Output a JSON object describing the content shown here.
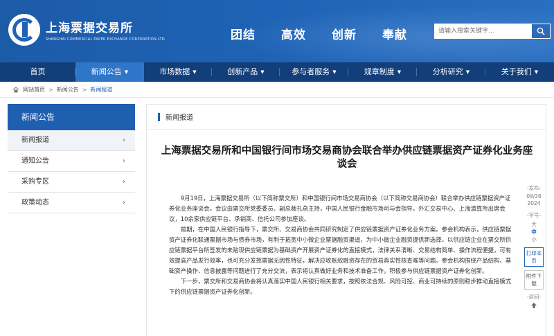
{
  "header": {
    "logo_cn": "上海票据交易所",
    "logo_en": "SHANGHAI COMMERCIAL PAPER EXCHANGE CORPORATION LTD.",
    "slogans": [
      "团结",
      "高效",
      "创新",
      "奉献"
    ],
    "search_placeholder": "请输入搜索关键字..."
  },
  "nav": {
    "items": [
      {
        "label": "首页",
        "caret": ""
      },
      {
        "label": "新闻公告",
        "caret": "▼"
      },
      {
        "label": "市场数据",
        "caret": "▼"
      },
      {
        "label": "创新产品",
        "caret": "▼"
      },
      {
        "label": "参与者服务",
        "caret": "▼"
      },
      {
        "label": "规章制度",
        "caret": "▼"
      },
      {
        "label": "分析研究",
        "caret": "▼"
      },
      {
        "label": "关于我们",
        "caret": "▼"
      }
    ]
  },
  "breadcrumb": {
    "items": [
      "网站首页",
      "新闻公告",
      "新闻报道"
    ],
    "separator": ">"
  },
  "sidebar": {
    "title": "新闻公告",
    "items": [
      {
        "label": "新闻报道",
        "arrow": "›"
      },
      {
        "label": "通知公告",
        "arrow": "›"
      },
      {
        "label": "采购专区",
        "arrow": "›"
      },
      {
        "label": "政策动态",
        "arrow": "›"
      }
    ]
  },
  "main": {
    "section_label": "新闻报道",
    "title": "上海票据交易所和中国银行间市场交易商协会联合举办供应链票据资产证券化业务座谈会",
    "paragraphs": [
      "9月19日，上海票据交易所（以下简称票交所）和中国银行间市场交易商协会（以下简称交易商协会）联合举办供应链票据资产证券化业务座谈会。会议由票交所党委委员、副总裁孔燕主持，中国人民银行金融市场司与会指导，外汇交易中心、上海清算所出席会议，10余家供应链平台、承销商、信托公司参加座谈。",
      "前期，在中国人民银行指导下，票交所、交易商协会共同研究制定了供应链票据资产证券化业务方案。参会机构表示，供应链票据资产证券化联通票据市场与债券市场，有利于拓宽中小微企业票据融资渠道，为中小微企业融资提供新选择。以供应链企业在票交所供应链票据平台所签发的未贴现供应链票据为基础资产开展资产证券化的直接模式，法律关系清晰、交易结构简单、操作流程便捷，可有效提高产品发行效率，也可充分发挥票据无因性特征，解决应收账款融资存在的贸易真实性核查难等问题。参会机构围绕产品结构、基础资产操作、信息披露等问题进行了充分交流，表示将认真做好业务和技术准备工作，积极参与供应链票据资产证券化创新。",
      "下一步，票交所和交易商协会将认真落实中国人民银行相关要求，按照依法合规、风险可控、商业可持续的原则稳步推动直接模式下的供应链票据资产证券化创新。"
    ]
  },
  "tools": {
    "publish_label": "-发布-",
    "publish_date": "09/26",
    "publish_year": "2024",
    "font_label": "-字号-",
    "font_sizes": [
      "大",
      "中",
      "小"
    ],
    "print_label": "打印本页",
    "attachment_label": "附件下载",
    "back_label": "-返回-",
    "back_icon": "arrow-up-icon"
  },
  "colors": {
    "header_blue": "#1f63b6",
    "nav_dark": "#123f7a",
    "nav_active": "#2f75c8",
    "sidebar_title": "#1f5fb0"
  }
}
